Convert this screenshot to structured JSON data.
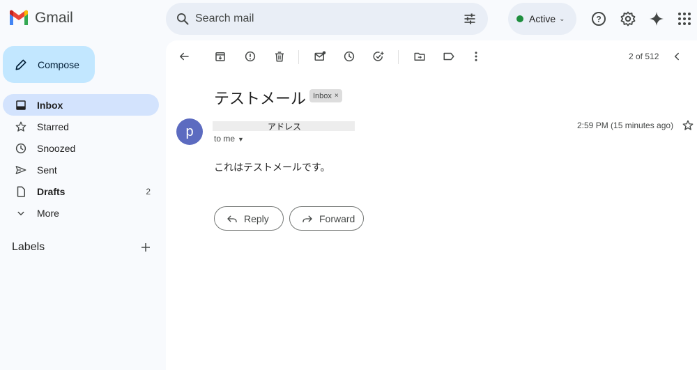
{
  "app": {
    "name": "Gmail"
  },
  "search": {
    "placeholder": "Search mail"
  },
  "status": {
    "label": "Active",
    "color": "#1e8e3e"
  },
  "header_icons": [
    "help-icon",
    "settings-icon",
    "gemini-icon",
    "apps-icon"
  ],
  "compose": {
    "label": "Compose"
  },
  "nav": {
    "items": [
      {
        "label": "Inbox",
        "icon": "inbox-icon",
        "active": true,
        "bold": true,
        "count": ""
      },
      {
        "label": "Starred",
        "icon": "star-icon",
        "active": false,
        "bold": false,
        "count": ""
      },
      {
        "label": "Snoozed",
        "icon": "clock-icon",
        "active": false,
        "bold": false,
        "count": ""
      },
      {
        "label": "Sent",
        "icon": "send-icon",
        "active": false,
        "bold": false,
        "count": ""
      },
      {
        "label": "Drafts",
        "icon": "draft-icon",
        "active": false,
        "bold": true,
        "count": "2"
      },
      {
        "label": "More",
        "icon": "chevron-down-icon",
        "active": false,
        "bold": false,
        "count": ""
      }
    ]
  },
  "labels": {
    "heading": "Labels"
  },
  "toolbar": {
    "icons": [
      "back-icon",
      "archive-icon",
      "report-spam-icon",
      "delete-icon",
      "mark-unread-icon",
      "snooze-icon",
      "add-task-icon",
      "move-to-icon",
      "label-icon",
      "more-vert-icon"
    ],
    "pager": "2 of 512"
  },
  "message": {
    "subject": "テストメール",
    "label_chip": "Inbox",
    "label_chip_close": "×",
    "avatar_letter": "p",
    "sender": "アドレス",
    "recipient": "to me",
    "timestamp": "2:59 PM (15 minutes ago)",
    "body": "これはテストメールです。"
  },
  "actions": {
    "reply": "Reply",
    "forward": "Forward"
  },
  "colors": {
    "compose_bg": "#c2e7ff",
    "active_nav_bg": "#d3e3fd",
    "avatar_bg": "#5c6bc0",
    "page_bg": "#f8fafd",
    "search_bg": "#e9eef6"
  }
}
